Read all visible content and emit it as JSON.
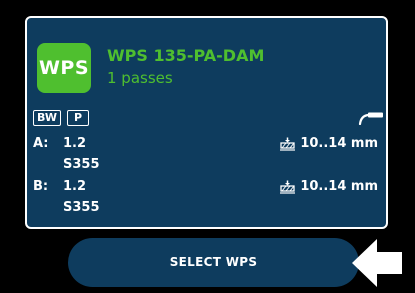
{
  "wps": {
    "badge": "WPS",
    "title": "WPS 135-PA-DAM",
    "passes": "1 passes"
  },
  "tags": {
    "joint": "BW",
    "position": "P"
  },
  "icons": {
    "torch": "welding-torch-icon",
    "thickness": "plate-thickness-icon",
    "pointer": "pointing-arrow-icon"
  },
  "parts": [
    {
      "label": "A:",
      "value": "1.2",
      "material": "S355",
      "range": "10..14 mm"
    },
    {
      "label": "B:",
      "value": "1.2",
      "material": "S355",
      "range": "10..14 mm"
    }
  ],
  "action": {
    "select_label": "SELECT WPS"
  },
  "colors": {
    "background": "#000000",
    "card": "#0e3c5e",
    "accent_green": "#4fbf2f",
    "text": "#ffffff"
  }
}
